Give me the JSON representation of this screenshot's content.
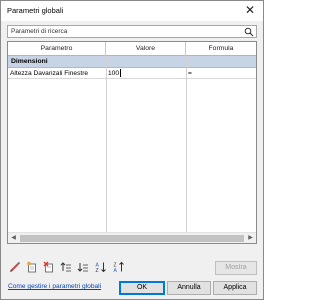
{
  "window": {
    "title": "Parametri globali",
    "close_glyph": "✕"
  },
  "search": {
    "placeholder": "Parametri di ricerca",
    "icon": "search-icon"
  },
  "table": {
    "columns": [
      "Parametro",
      "Valore",
      "Formula"
    ],
    "groups": [
      {
        "name": "Dimensioni",
        "rows": [
          {
            "parametro": "Altezza Davanzali Finestre",
            "valore": "100",
            "formula": "="
          }
        ]
      }
    ],
    "group_color": "#c6d4e6"
  },
  "toolbar": {
    "icons": [
      "edit-icon",
      "new-parameter-icon",
      "delete-parameter-icon",
      "move-up-icon",
      "move-down-icon",
      "sort-ascending-icon",
      "sort-descending-icon"
    ]
  },
  "buttons": {
    "show": "Mostra",
    "ok": "OK",
    "cancel": "Annulla",
    "apply": "Applica"
  },
  "help_link": "Come gestire i parametri globali",
  "accent_color": "#0078d7"
}
